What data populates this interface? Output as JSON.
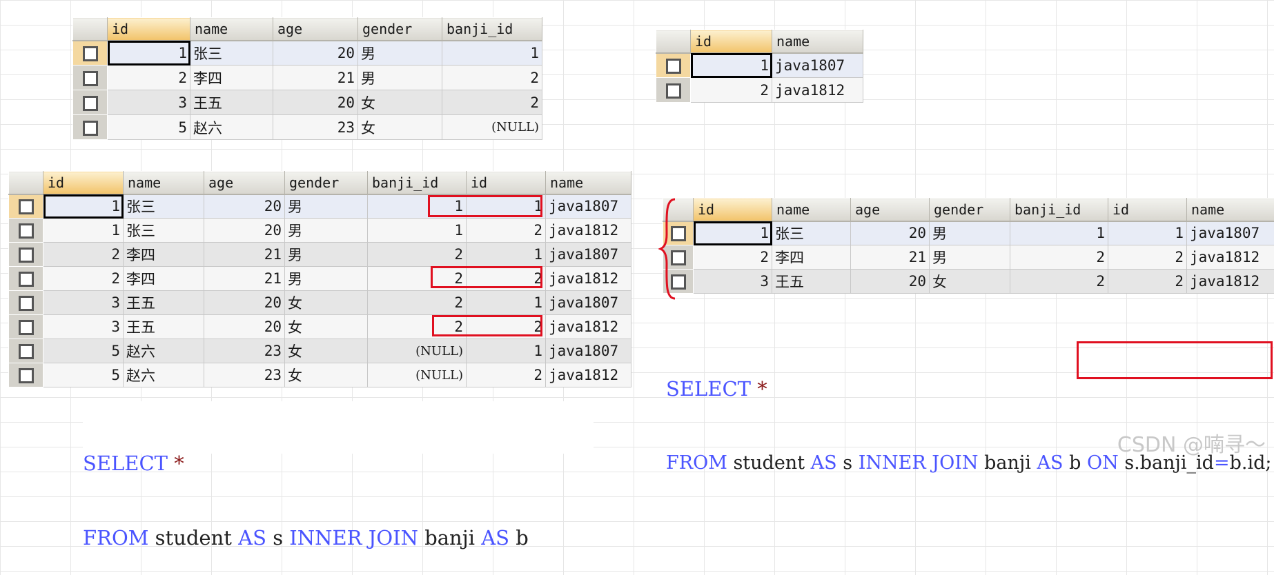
{
  "student_table": {
    "columns": [
      "id",
      "name",
      "age",
      "gender",
      "banji_id"
    ],
    "rows": [
      [
        "1",
        "张三",
        "20",
        "男",
        "1"
      ],
      [
        "2",
        "李四",
        "21",
        "男",
        "2"
      ],
      [
        "3",
        "王五",
        "20",
        "女",
        "2"
      ],
      [
        "5",
        "赵六",
        "23",
        "女",
        "(NULL)"
      ]
    ]
  },
  "banji_table": {
    "columns": [
      "id",
      "name"
    ],
    "rows": [
      [
        "1",
        "java1807"
      ],
      [
        "2",
        "java1812"
      ]
    ]
  },
  "cross_join_table": {
    "columns": [
      "id",
      "name",
      "age",
      "gender",
      "banji_id",
      "id",
      "name"
    ],
    "rows": [
      [
        "1",
        "张三",
        "20",
        "男",
        "1",
        "1",
        "java1807"
      ],
      [
        "1",
        "张三",
        "20",
        "男",
        "1",
        "2",
        "java1812"
      ],
      [
        "2",
        "李四",
        "21",
        "男",
        "2",
        "1",
        "java1807"
      ],
      [
        "2",
        "李四",
        "21",
        "男",
        "2",
        "2",
        "java1812"
      ],
      [
        "3",
        "王五",
        "20",
        "女",
        "2",
        "1",
        "java1807"
      ],
      [
        "3",
        "王五",
        "20",
        "女",
        "2",
        "2",
        "java1812"
      ],
      [
        "5",
        "赵六",
        "23",
        "女",
        "(NULL)",
        "1",
        "java1807"
      ],
      [
        "5",
        "赵六",
        "23",
        "女",
        "(NULL)",
        "2",
        "java1812"
      ]
    ]
  },
  "inner_join_table": {
    "columns": [
      "id",
      "name",
      "age",
      "gender",
      "banji_id",
      "id",
      "name"
    ],
    "rows": [
      [
        "1",
        "张三",
        "20",
        "男",
        "1",
        "1",
        "java1807"
      ],
      [
        "2",
        "李四",
        "21",
        "男",
        "2",
        "2",
        "java1812"
      ],
      [
        "3",
        "王五",
        "20",
        "女",
        "2",
        "2",
        "java1812"
      ]
    ]
  },
  "sql_left": {
    "select": "SELECT",
    "star": "*",
    "from": "FROM",
    "t1": "student",
    "as1": "AS",
    "a1": "s",
    "inner": "INNER",
    "join": "JOIN",
    "t2": "banji",
    "as2": "AS",
    "a2": "b"
  },
  "sql_right": {
    "select": "SELECT",
    "star": "*",
    "from": "FROM",
    "t1": "student",
    "as1": "AS",
    "a1": "s",
    "inner": "INNER",
    "join": "JOIN",
    "t2": "banji",
    "as2": "AS",
    "a2": "b",
    "on": "ON",
    "cond_left": "s.banji_id",
    "eq": "=",
    "cond_right": "b.id;"
  },
  "watermark": "CSDN @喃寻～",
  "colors": {
    "highlight_box": "#e01020",
    "sql_keyword": "#4a54ff",
    "active_header": "#f2c36a"
  }
}
